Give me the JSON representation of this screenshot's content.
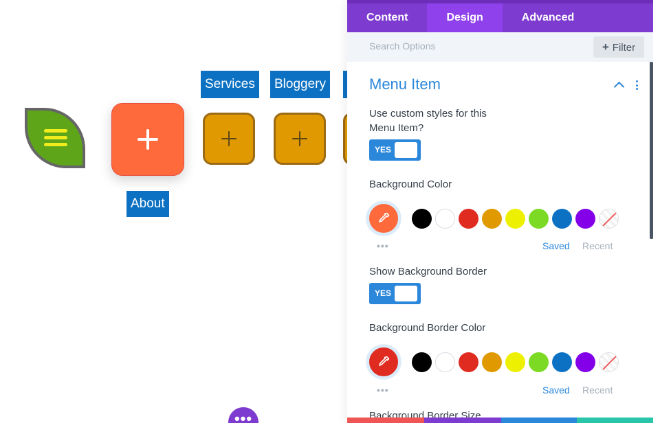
{
  "preview": {
    "menu_links": {
      "services": "Services",
      "bloggery": "Bloggery",
      "about": "About"
    },
    "fab_dots": "•••"
  },
  "panel": {
    "tabs": [
      {
        "label": "Content",
        "active": false
      },
      {
        "label": "Design",
        "active": true
      },
      {
        "label": "Advanced",
        "active": false
      }
    ],
    "search": {
      "placeholder": "Search Options"
    },
    "filter_label": "Filter",
    "section": {
      "title": "Menu Item",
      "icons": [
        "chevron-up-icon",
        "kebab-menu-icon"
      ]
    },
    "custom_styles": {
      "label": "Use custom styles for this Menu Item?",
      "toggle": "YES"
    },
    "background_color": {
      "label": "Background Color",
      "selected": "#ff6a3d",
      "swatches": [
        "#000000",
        "#ffffff",
        "#e02b20",
        "#e09900",
        "#edf000",
        "#7cda24",
        "#0c71c3",
        "#8300e9",
        "none"
      ],
      "more": "•••",
      "saved_label": "Saved",
      "recent_label": "Recent"
    },
    "show_border": {
      "label": "Show Background Border",
      "toggle": "YES"
    },
    "border_color": {
      "label": "Background Border Color",
      "selected": "#e02b20",
      "swatches": [
        "#000000",
        "#ffffff",
        "#e02b20",
        "#e09900",
        "#edf000",
        "#7cda24",
        "#0c71c3",
        "#8300e9",
        "none"
      ],
      "more": "•••",
      "saved_label": "Saved",
      "recent_label": "Recent"
    },
    "border_size": {
      "label": "Background Border Size"
    }
  },
  "colors": {
    "accent_blue": "#2b87da",
    "tab_purple": "#7e3bd0",
    "menu_link_blue": "#0c71c3",
    "bottom_strip": [
      "#ef5555",
      "#7e3bd0",
      "#2b87da",
      "#29c4a9"
    ]
  }
}
